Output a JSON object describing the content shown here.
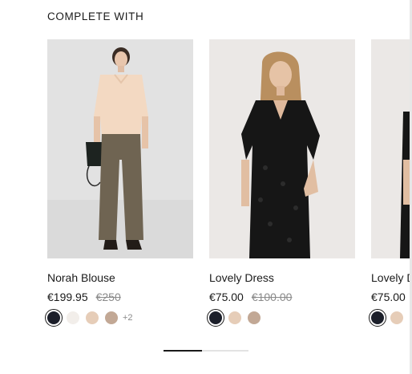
{
  "section": {
    "title": "COMPLETE WITH"
  },
  "carousel": {
    "progress": 0.45
  },
  "products": [
    {
      "name": "Norah Blouse",
      "price": "€199.95",
      "old_price": "€250",
      "image": "model-beige-blouse-trousers",
      "swatches": [
        "#1c1f2a",
        "#f2eeea",
        "#e6cdb8",
        "#c2a895"
      ],
      "more": "+2"
    },
    {
      "name": "Lovely Dress",
      "price": "€75.00",
      "old_price": "€100.00",
      "image": "model-black-lace-dress",
      "swatches": [
        "#1c1f2a",
        "#e6cdb8",
        "#c2a895"
      ],
      "more": ""
    },
    {
      "name": "Lovely Dress",
      "price": "€75.00",
      "old_price": "",
      "image": "model-black-lace-dress",
      "swatches": [
        "#1c1f2a",
        "#e6cdb8"
      ],
      "more": ""
    }
  ]
}
